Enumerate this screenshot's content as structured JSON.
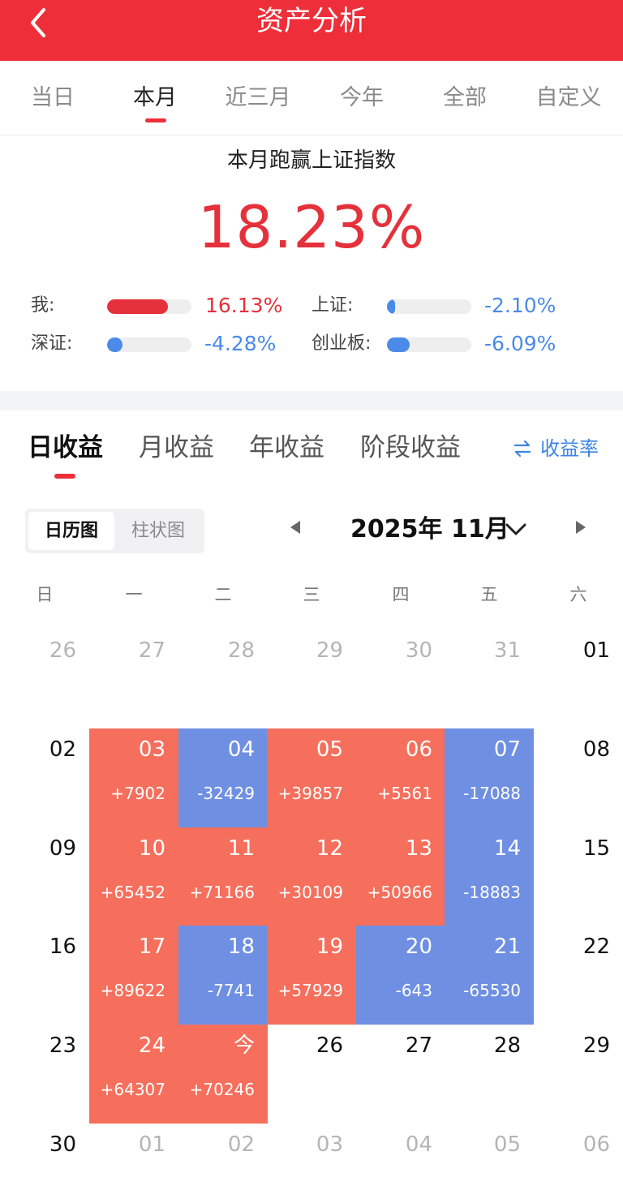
{
  "header": {
    "title": "资产分析",
    "back_icon": "chevron-left-icon"
  },
  "range_tabs": [
    {
      "label": "当日",
      "active": false
    },
    {
      "label": "本月",
      "active": true
    },
    {
      "label": "近三月",
      "active": false
    },
    {
      "label": "今年",
      "active": false
    },
    {
      "label": "全部",
      "active": false
    },
    {
      "label": "自定义",
      "active": false
    }
  ],
  "summary": {
    "title": "本月跑赢上证指数",
    "value": "18.23%",
    "comparisons": [
      {
        "label": "我:",
        "value": "16.13%",
        "fill": 0.72,
        "color": "#e5313b"
      },
      {
        "label": "上证:",
        "value": "-2.10%",
        "fill": 0.09,
        "color": "#4a8ae8"
      },
      {
        "label": "深证:",
        "value": "-4.28%",
        "fill": 0.18,
        "color": "#4a8ae8"
      },
      {
        "label": "创业板:",
        "value": "-6.09%",
        "fill": 0.27,
        "color": "#4a8ae8"
      }
    ]
  },
  "profit_tabs": [
    {
      "label": "日收益",
      "active": true
    },
    {
      "label": "月收益",
      "active": false
    },
    {
      "label": "年收益",
      "active": false
    },
    {
      "label": "阶段收益",
      "active": false
    }
  ],
  "rate_toggle": {
    "icon": "swap-icon",
    "label": "收益率"
  },
  "view_toggle": {
    "calendar": "日历图",
    "bar": "柱状图"
  },
  "month_nav": {
    "label": "2025年 11月",
    "prev_icon": "triangle-left-icon",
    "next_icon": "triangle-right-icon",
    "dropdown_icon": "chevron-down-icon"
  },
  "weekdays": [
    "日",
    "一",
    "二",
    "三",
    "四",
    "五",
    "六"
  ],
  "colors": {
    "brand": "#ee2f39",
    "gain": "#f56f5c",
    "loss": "#6f8fe3",
    "positive_text": "#e5313b",
    "negative_text": "#4a8ae8"
  },
  "calendar": [
    [
      {
        "day": "26",
        "type": "other"
      },
      {
        "day": "27",
        "type": "other"
      },
      {
        "day": "28",
        "type": "other"
      },
      {
        "day": "29",
        "type": "other"
      },
      {
        "day": "30",
        "type": "other"
      },
      {
        "day": "31",
        "type": "other"
      },
      {
        "day": "01",
        "type": "normal"
      }
    ],
    [
      {
        "day": "02",
        "type": "normal"
      },
      {
        "day": "03",
        "type": "gain",
        "amount": "+7902"
      },
      {
        "day": "04",
        "type": "loss",
        "amount": "-32429"
      },
      {
        "day": "05",
        "type": "gain",
        "amount": "+39857"
      },
      {
        "day": "06",
        "type": "gain",
        "amount": "+5561"
      },
      {
        "day": "07",
        "type": "loss",
        "amount": "-17088"
      },
      {
        "day": "08",
        "type": "normal"
      }
    ],
    [
      {
        "day": "09",
        "type": "normal"
      },
      {
        "day": "10",
        "type": "gain",
        "amount": "+65452"
      },
      {
        "day": "11",
        "type": "gain",
        "amount": "+71166"
      },
      {
        "day": "12",
        "type": "gain",
        "amount": "+30109"
      },
      {
        "day": "13",
        "type": "gain",
        "amount": "+50966"
      },
      {
        "day": "14",
        "type": "loss",
        "amount": "-18883"
      },
      {
        "day": "15",
        "type": "normal"
      }
    ],
    [
      {
        "day": "16",
        "type": "normal"
      },
      {
        "day": "17",
        "type": "gain",
        "amount": "+89622"
      },
      {
        "day": "18",
        "type": "loss",
        "amount": "-7741"
      },
      {
        "day": "19",
        "type": "gain",
        "amount": "+57929"
      },
      {
        "day": "20",
        "type": "loss",
        "amount": "-643"
      },
      {
        "day": "21",
        "type": "loss",
        "amount": "-65530"
      },
      {
        "day": "22",
        "type": "normal"
      }
    ],
    [
      {
        "day": "23",
        "type": "normal"
      },
      {
        "day": "24",
        "type": "gain",
        "amount": "+64307"
      },
      {
        "day": "今",
        "type": "gain",
        "amount": "+70246"
      },
      {
        "day": "26",
        "type": "normal"
      },
      {
        "day": "27",
        "type": "normal"
      },
      {
        "day": "28",
        "type": "normal"
      },
      {
        "day": "29",
        "type": "normal"
      }
    ],
    [
      {
        "day": "30",
        "type": "normal"
      },
      {
        "day": "01",
        "type": "other"
      },
      {
        "day": "02",
        "type": "other"
      },
      {
        "day": "03",
        "type": "other"
      },
      {
        "day": "04",
        "type": "other"
      },
      {
        "day": "05",
        "type": "other"
      },
      {
        "day": "06",
        "type": "other"
      }
    ]
  ]
}
